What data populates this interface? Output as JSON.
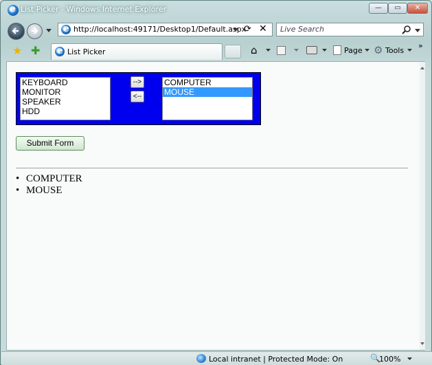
{
  "window": {
    "title": "List Picker - Windows Internet Explorer",
    "controls": {
      "minimize": "—",
      "maximize": "▭",
      "close": "✕"
    }
  },
  "nav": {
    "url": "http://localhost:49171/Desktop1/Default.aspx",
    "search_placeholder": "Live Search"
  },
  "tabs": [
    {
      "label": "List Picker"
    }
  ],
  "commands": {
    "page": "Page",
    "tools": "Tools"
  },
  "picker": {
    "available": [
      "KEYBOARD",
      "MONITOR",
      "SPEAKER",
      "HDD"
    ],
    "selected": [
      "COMPUTER",
      "MOUSE"
    ],
    "highlighted_selected": "MOUSE",
    "add_label": "-->",
    "remove_label": "<--"
  },
  "form": {
    "submit_label": "Submit Form"
  },
  "results": [
    "COMPUTER",
    "MOUSE"
  ],
  "status": {
    "zone": "Local intranet | Protected Mode: On",
    "zoom": "100%"
  },
  "colors": {
    "picker_bg": "#0000ee",
    "selection": "#3399ff"
  }
}
